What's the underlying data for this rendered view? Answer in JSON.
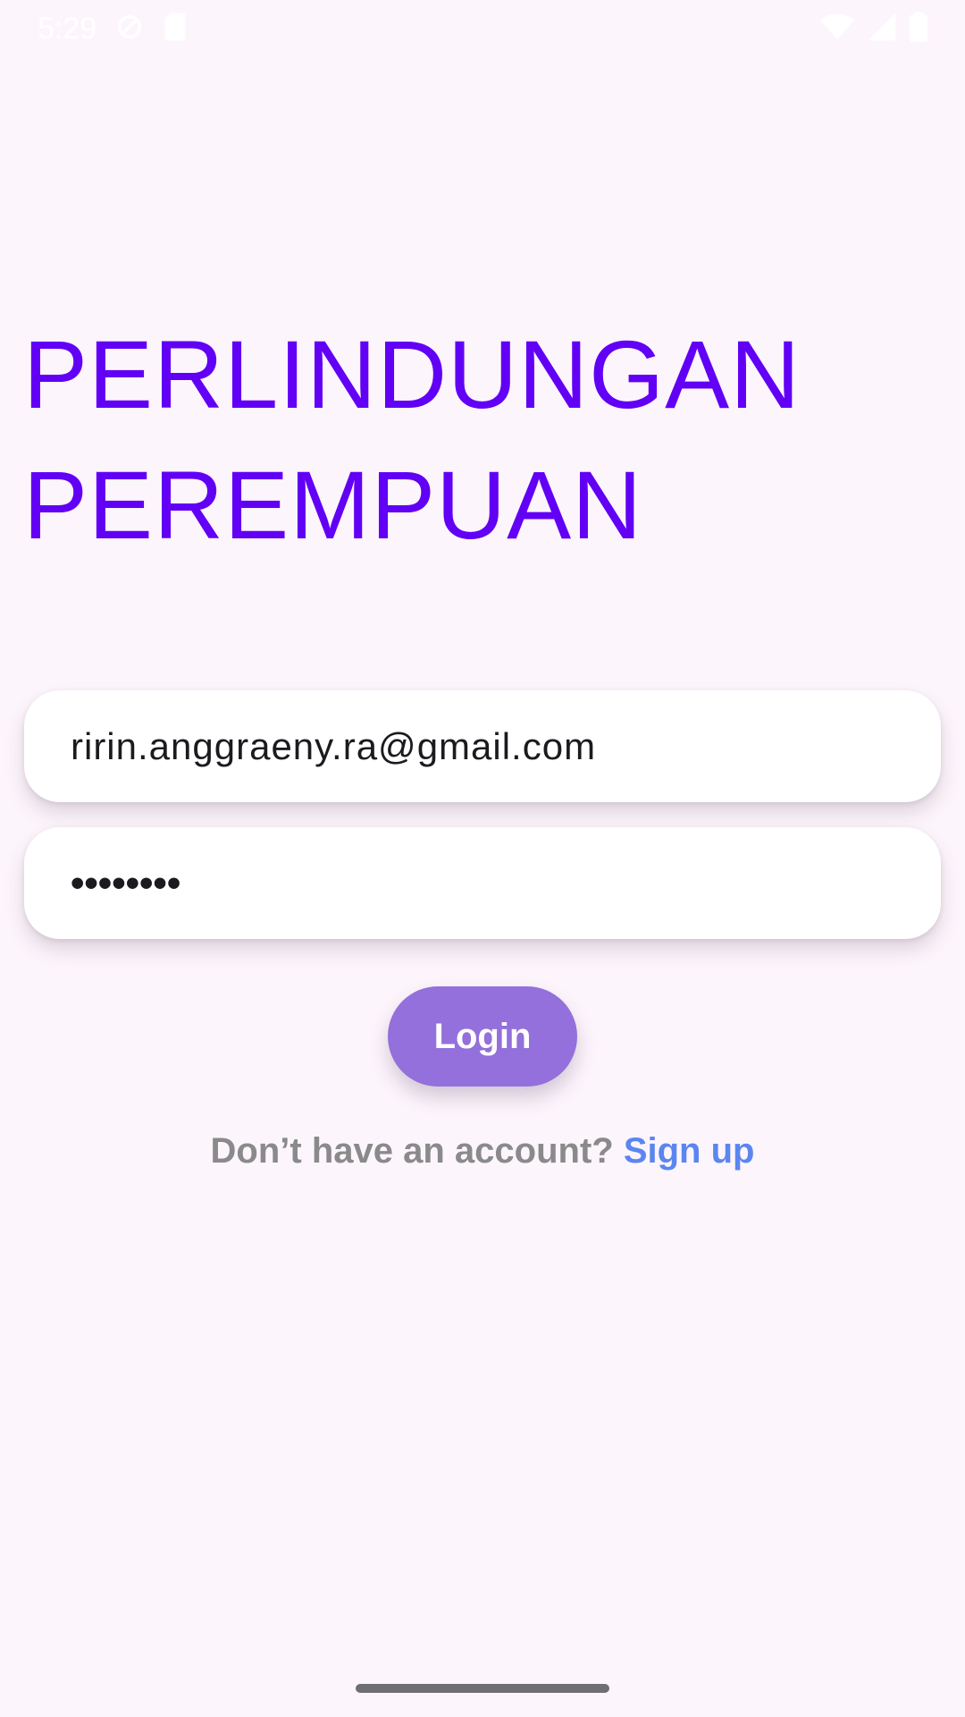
{
  "status_bar": {
    "time": "5:29",
    "left_icons": [
      "data-saver-icon",
      "sim-card-icon"
    ],
    "right_icons": [
      "wifi-icon",
      "signal-icon",
      "battery-icon"
    ]
  },
  "title": {
    "line1": "PERLINDUNGAN",
    "line2": "PEREMPUAN",
    "color": "#6100f5"
  },
  "form": {
    "email_value": "ririn.anggraeny.ra@gmail.com",
    "password_masked": "••••••••",
    "login_label": "Login",
    "login_color": "#9370db"
  },
  "signup": {
    "prompt": "Don’t have an account? ",
    "link_label": "Sign up",
    "link_color": "#5b86f0"
  }
}
